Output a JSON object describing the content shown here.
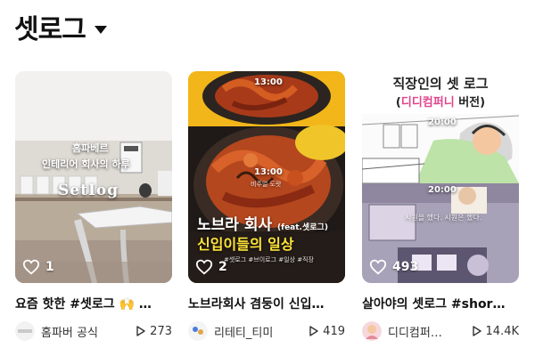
{
  "header": {
    "title": "셋로그"
  },
  "cards": [
    {
      "title": "요즘 핫한 #셋로그 🙌 …",
      "likes": "1",
      "channel": "홈파버 공식",
      "views": "273",
      "overlay": {
        "line1": "홈파베르",
        "line2": "인테리어 회사의 하루",
        "line3": "SetIog"
      }
    },
    {
      "title": "노브라회사 겸둥이 신입…",
      "likes": "2",
      "channel": "리테티_티미",
      "views": "419",
      "overlay": {
        "time_top": "13:00",
        "time_mid": "13:00",
        "caption_mid": "비주얼 도랏",
        "line_main": "노브라 회사",
        "line_feat": "(feat.셋로그)",
        "line_yellow": "신입이들의 일상",
        "tags": "#셋로그 #브이로그 #일상 #직장"
      }
    },
    {
      "title": "살아야의 셋로그 #shor…",
      "likes": "493",
      "channel": "디디컴퍼…",
      "views": "14.4K",
      "overlay": {
        "banner_line1": "직장인의 셋 로그",
        "banner_open": "(",
        "banner_company": "디디컴퍼니",
        "banner_close": " 버전)",
        "time_a": "20:00",
        "time_b": "20:00",
        "caption": "시원을 했다. 시원은 했다."
      }
    }
  ],
  "colors": {
    "heart": "#ffffff",
    "yellow_caption": "#ffe438",
    "banner_highlight": "#e0448c"
  },
  "icons": {
    "header_caret": "chevron-down-icon",
    "likes": "heart-icon",
    "views": "play-icon"
  }
}
